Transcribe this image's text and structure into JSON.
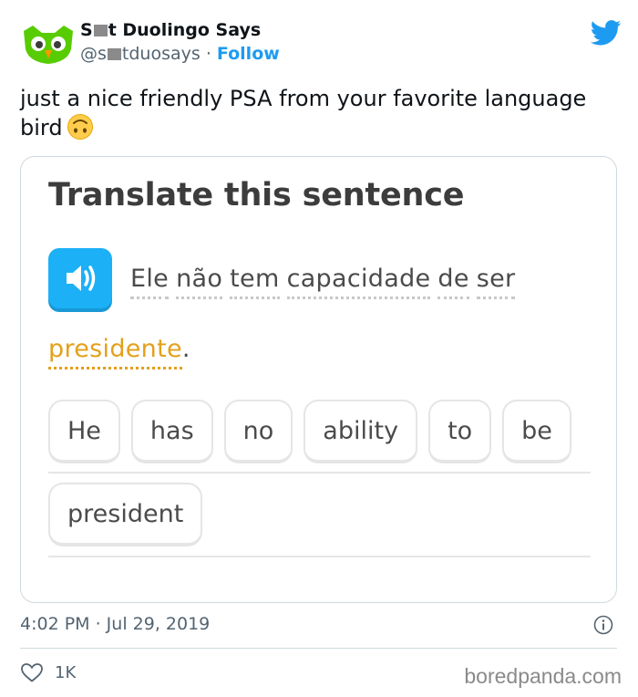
{
  "header": {
    "display_name_start": "S",
    "display_name_end": "t Duolingo Says",
    "handle_start": "@s",
    "handle_end": "tduosays",
    "separator": " · ",
    "follow_label": "Follow"
  },
  "tweet": {
    "text": "just a nice friendly PSA from your favorite language bird",
    "emoji": "upside-down-face"
  },
  "media": {
    "title": "Translate this sentence",
    "prompt_line1": [
      "Ele",
      "não",
      "tem",
      "capacidade",
      "de",
      "ser"
    ],
    "prompt_word_last": "presidente",
    "prompt_period": ".",
    "word_bank_row1": [
      "He",
      "has",
      "no",
      "ability",
      "to",
      "be"
    ],
    "word_bank_row2": [
      "president"
    ]
  },
  "footer": {
    "timestamp": "4:02 PM · Jul 29, 2019",
    "like_count": "1K",
    "watermark": "boredpanda.com"
  },
  "colors": {
    "twitter_blue": "#1d9bf0",
    "duolingo_blue": "#1cb0f6",
    "owl_green": "#58cc02",
    "highlight_orange": "#e3a01b"
  }
}
